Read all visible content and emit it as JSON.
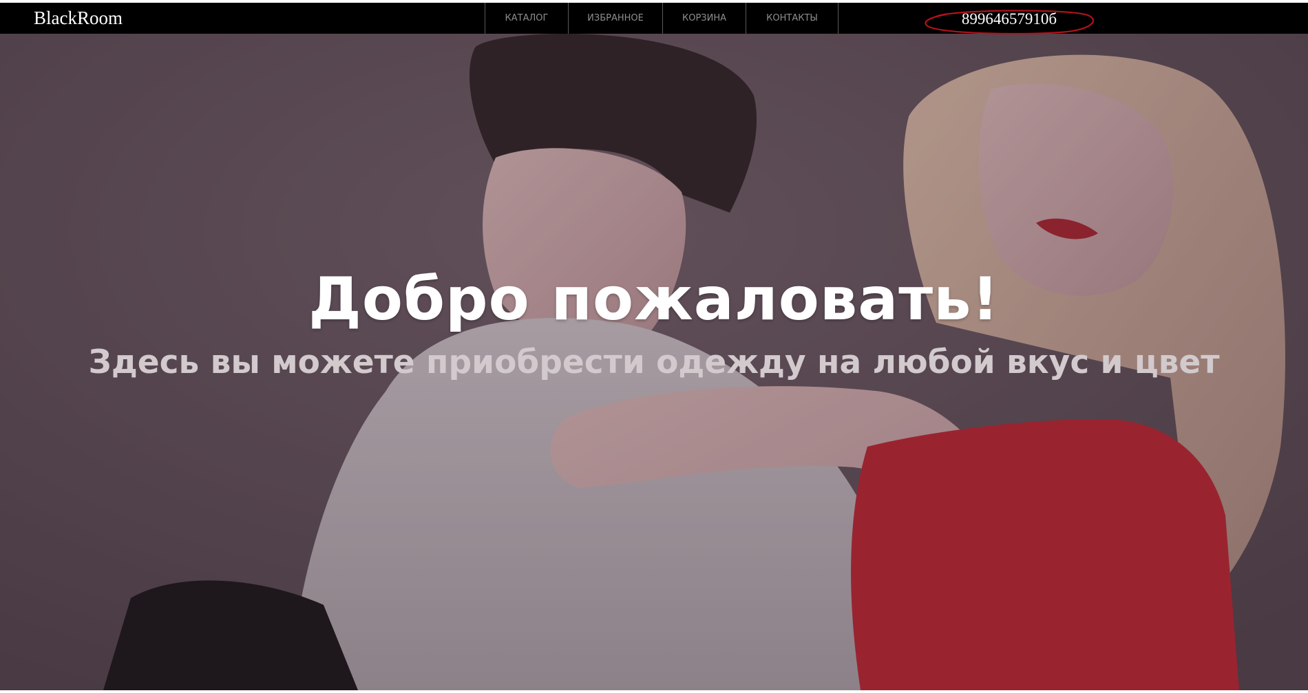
{
  "header": {
    "logo": "BlackRoom",
    "nav": [
      {
        "label": "КАТАЛОГ"
      },
      {
        "label": "ИЗБРАННОЕ"
      },
      {
        "label": "КОРЗИНА"
      },
      {
        "label": "КОНТАКТЫ"
      }
    ],
    "phone": "89964657910б"
  },
  "hero": {
    "title": "Добро пожаловать!",
    "subtitle": "Здесь вы можете приобрести одежду на любой вкус и цвет"
  },
  "colors": {
    "topbar": "#000000",
    "nav_text": "#8e8e8e",
    "phone_ellipse": "#b3121b",
    "title": "#ffffff",
    "subtitle": "#d2cacd"
  }
}
